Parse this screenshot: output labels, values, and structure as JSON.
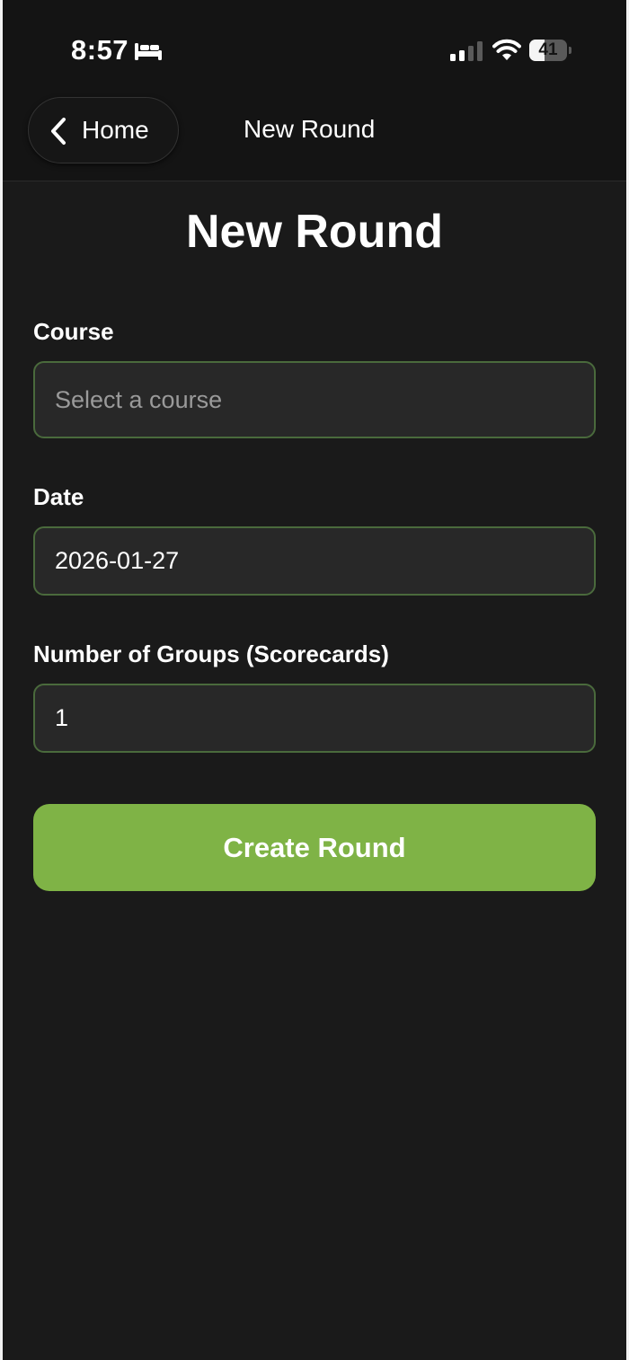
{
  "status_bar": {
    "time": "8:57",
    "focus_icon": "bed-icon",
    "signal_icon": "cellular-signal-icon",
    "wifi_icon": "wifi-icon",
    "battery_level": "41",
    "battery_fraction": 0.41
  },
  "nav": {
    "back_label": "Home",
    "back_icon": "chevron-left-icon",
    "title": "New Round"
  },
  "page": {
    "heading": "New Round"
  },
  "form": {
    "course": {
      "label": "Course",
      "placeholder": "Select a course",
      "value": ""
    },
    "date": {
      "label": "Date",
      "value": "2026-01-27"
    },
    "groups": {
      "label": "Number of Groups (Scorecards)",
      "value": "1"
    },
    "submit_label": "Create Round"
  },
  "colors": {
    "background": "#1a1a1a",
    "header_background": "#141414",
    "field_background": "#282828",
    "field_border": "#4a6a3c",
    "accent": "#7fb346"
  }
}
